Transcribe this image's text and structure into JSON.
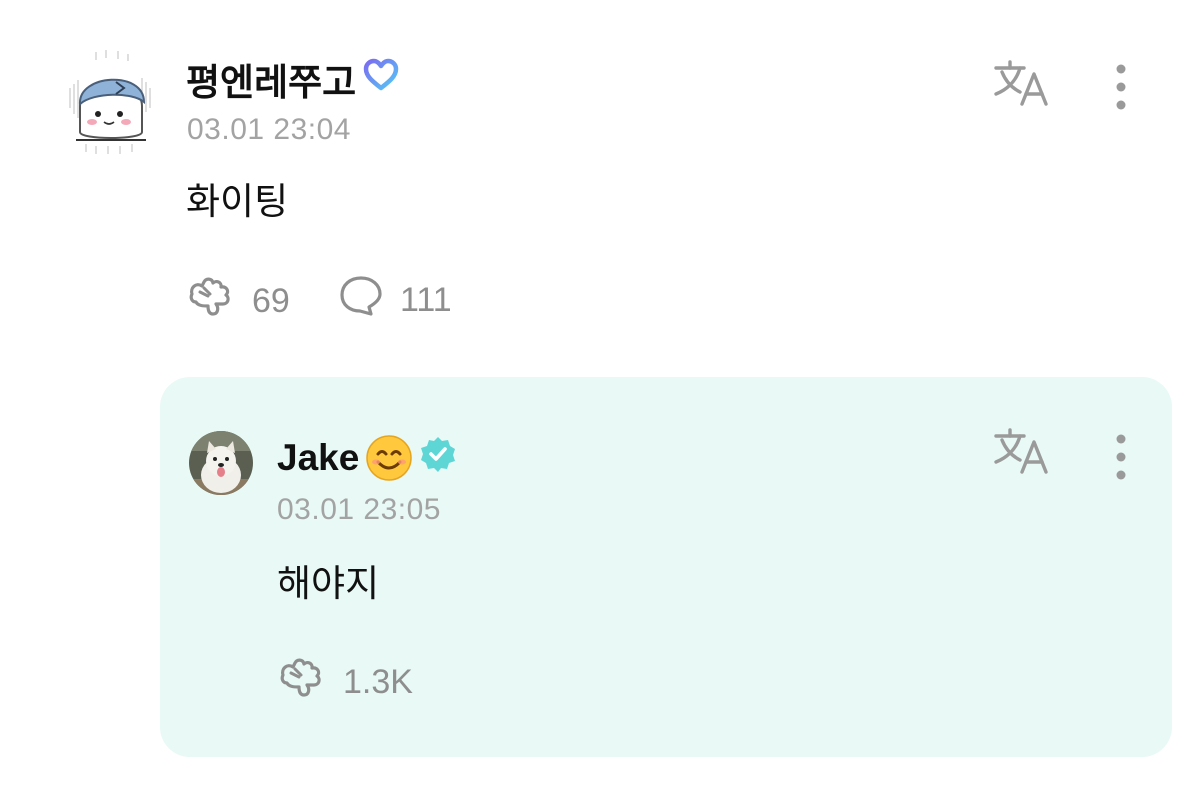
{
  "main_comment": {
    "author": "평엔레쭈고",
    "timestamp": "03.01 23:04",
    "body": "화이팅",
    "like_count": "69",
    "reply_count": "111"
  },
  "reply": {
    "author": "Jake",
    "timestamp": "03.01 23:05",
    "body": "해야지",
    "like_count": "1.3K"
  },
  "colors": {
    "reply_background": "#e8f9f6",
    "timestamp": "#a3a3a3",
    "icon_gray": "#8e8e8e",
    "verified_badge": "#5fd6d6",
    "heart_gradient_start": "#7a6cf0",
    "heart_gradient_end": "#55c9f5"
  },
  "icons": {
    "main_badge": "heart-outline-gradient-icon",
    "reply_badge": "verified-badge-icon",
    "reply_emoji": "smiling-face-emoji",
    "like": "like-hand-icon",
    "reply": "speech-bubble-icon",
    "translate": "translate-icon",
    "more": "more-vertical-icon"
  }
}
